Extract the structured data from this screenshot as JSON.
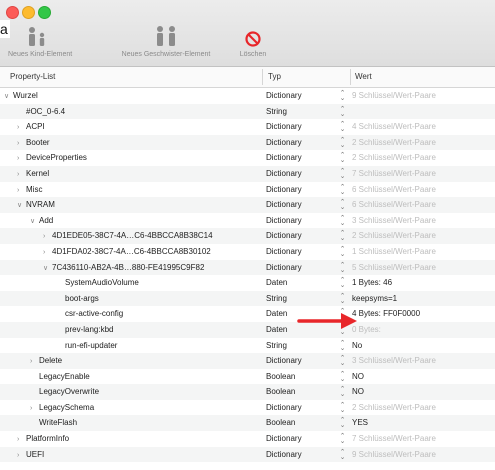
{
  "toolbar": {
    "new_child_label": "Neues Kind-Element",
    "new_sibling_label": "Neues Geschwister-Element",
    "delete_label": "Löschen",
    "stray_char": "a"
  },
  "columns": {
    "key": "Property-List",
    "type": "Typ",
    "value": "Wert"
  },
  "colors": {
    "annotation_arrow": "#e8262a",
    "close": "#fc5b57",
    "minimize": "#fdbb2e",
    "zoom": "#33c748",
    "delete_icon": "#e8262a"
  },
  "rows": [
    {
      "key": "Wurzel",
      "indent": 0,
      "tri": "down",
      "type": "Dictionary",
      "value": "9 Schlüssel/Wert-Paare",
      "dim": true
    },
    {
      "key": "#OC_0-6.4",
      "indent": 1,
      "tri": "",
      "type": "String",
      "value": "",
      "dim": false
    },
    {
      "key": "ACPI",
      "indent": 1,
      "tri": "right",
      "type": "Dictionary",
      "value": "4 Schlüssel/Wert-Paare",
      "dim": true
    },
    {
      "key": "Booter",
      "indent": 1,
      "tri": "right",
      "type": "Dictionary",
      "value": "2 Schlüssel/Wert-Paare",
      "dim": true
    },
    {
      "key": "DeviceProperties",
      "indent": 1,
      "tri": "right",
      "type": "Dictionary",
      "value": "2 Schlüssel/Wert-Paare",
      "dim": true
    },
    {
      "key": "Kernel",
      "indent": 1,
      "tri": "right",
      "type": "Dictionary",
      "value": "7 Schlüssel/Wert-Paare",
      "dim": true
    },
    {
      "key": "Misc",
      "indent": 1,
      "tri": "right",
      "type": "Dictionary",
      "value": "6 Schlüssel/Wert-Paare",
      "dim": true
    },
    {
      "key": "NVRAM",
      "indent": 1,
      "tri": "down",
      "type": "Dictionary",
      "value": "6 Schlüssel/Wert-Paare",
      "dim": true
    },
    {
      "key": "Add",
      "indent": 2,
      "tri": "down",
      "type": "Dictionary",
      "value": "3 Schlüssel/Wert-Paare",
      "dim": true
    },
    {
      "key": "4D1EDE05-38C7-4A…C6-4BBCCA8B38C14",
      "indent": 3,
      "tri": "right",
      "type": "Dictionary",
      "value": "2 Schlüssel/Wert-Paare",
      "dim": true
    },
    {
      "key": "4D1FDA02-38C7-4A…C6-4BBCCA8B30102",
      "indent": 3,
      "tri": "right",
      "type": "Dictionary",
      "value": "1 Schlüssel/Wert-Paare",
      "dim": true
    },
    {
      "key": "7C436110-AB2A-4B…880-FE41995C9F82",
      "indent": 3,
      "tri": "down",
      "type": "Dictionary",
      "value": "5 Schlüssel/Wert-Paare",
      "dim": true
    },
    {
      "key": "SystemAudioVolume",
      "indent": 4,
      "tri": "",
      "type": "Daten",
      "value": "1 Bytes: 46",
      "dim": false
    },
    {
      "key": "boot-args",
      "indent": 4,
      "tri": "",
      "type": "String",
      "value": "keepsyms=1",
      "dim": false
    },
    {
      "key": "csr-active-config",
      "indent": 4,
      "tri": "",
      "type": "Daten",
      "value": "4 Bytes: FF0F0000",
      "dim": false
    },
    {
      "key": "prev-lang:kbd",
      "indent": 4,
      "tri": "",
      "type": "Daten",
      "value": "0 Bytes:",
      "dim": true
    },
    {
      "key": "run-efi-updater",
      "indent": 4,
      "tri": "",
      "type": "String",
      "value": "No",
      "dim": false
    },
    {
      "key": "Delete",
      "indent": 2,
      "tri": "right",
      "type": "Dictionary",
      "value": "3 Schlüssel/Wert-Paare",
      "dim": true
    },
    {
      "key": "LegacyEnable",
      "indent": 2,
      "tri": "",
      "type": "Boolean",
      "value": "NO",
      "dim": false
    },
    {
      "key": "LegacyOverwrite",
      "indent": 2,
      "tri": "",
      "type": "Boolean",
      "value": "NO",
      "dim": false
    },
    {
      "key": "LegacySchema",
      "indent": 2,
      "tri": "right",
      "type": "Dictionary",
      "value": "2 Schlüssel/Wert-Paare",
      "dim": true
    },
    {
      "key": "WriteFlash",
      "indent": 2,
      "tri": "",
      "type": "Boolean",
      "value": "YES",
      "dim": false
    },
    {
      "key": "PlatformInfo",
      "indent": 1,
      "tri": "right",
      "type": "Dictionary",
      "value": "7 Schlüssel/Wert-Paare",
      "dim": true
    },
    {
      "key": "UEFI",
      "indent": 1,
      "tri": "right",
      "type": "Dictionary",
      "value": "9 Schlüssel/Wert-Paare",
      "dim": true
    }
  ]
}
